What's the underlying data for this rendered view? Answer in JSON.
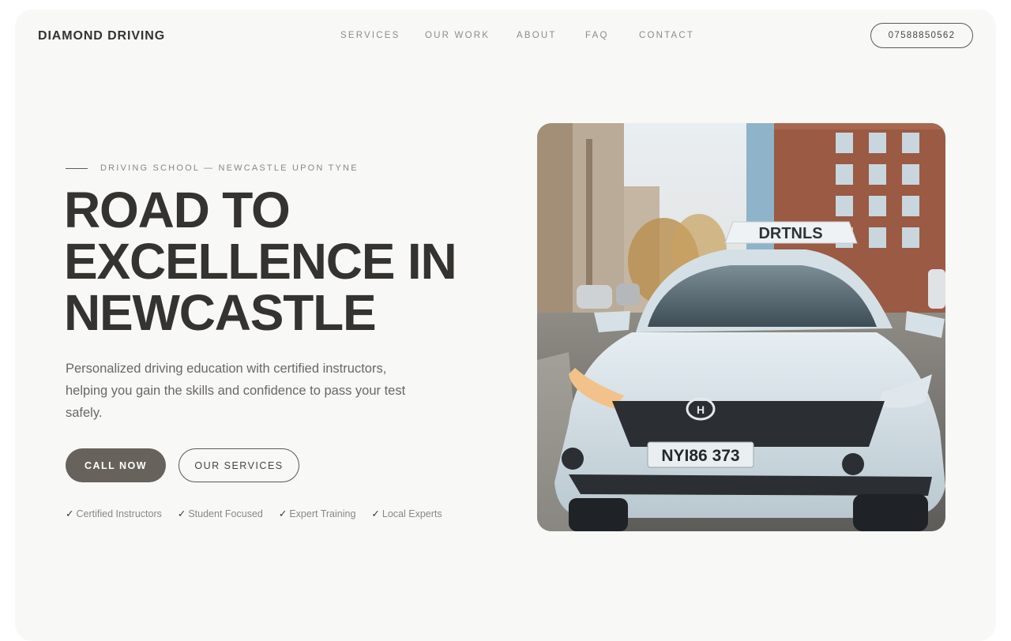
{
  "brand": {
    "name": "DIAMOND DRIVING"
  },
  "nav": {
    "items": [
      {
        "label": "SERVICES"
      },
      {
        "label": "OUR WORK"
      },
      {
        "label": "ABOUT"
      },
      {
        "label": "FAQ"
      },
      {
        "label": "CONTACT"
      }
    ],
    "phone": "07588850562"
  },
  "hero": {
    "eyebrow": "DRIVING SCHOOL — NEWCASTLE UPON TYNE",
    "headline": "ROAD TO EXCELLENCE IN NEWCASTLE",
    "subtext": "Personalized driving education with certified instructors, helping you gain the skills and confidence to pass your test safely.",
    "primary_cta": "CALL NOW",
    "secondary_cta": "OUR SERVICES",
    "features": [
      {
        "label": "Certified Instructors"
      },
      {
        "label": "Student Focused"
      },
      {
        "label": "Expert Training"
      },
      {
        "label": "Local Experts"
      }
    ],
    "image": {
      "roof_sign": "DRTNLS",
      "plate": "NYI86 373"
    }
  },
  "colors": {
    "page_bg": "#f8f8f6",
    "text_dark": "#35332f",
    "text_muted": "#8a8882",
    "button_fill": "#67625b"
  },
  "icons": {
    "check": "check-icon"
  }
}
